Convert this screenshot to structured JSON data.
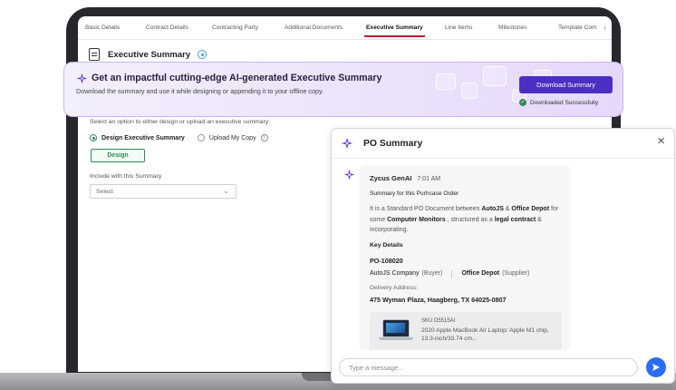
{
  "tabs": [
    {
      "label": "Basic Details",
      "active": false
    },
    {
      "label": "Contract Details",
      "active": false
    },
    {
      "label": "Contracting Party",
      "active": false
    },
    {
      "label": "Additional Documents",
      "active": false
    },
    {
      "label": "Executive Summary",
      "active": true
    },
    {
      "label": "Line Items",
      "active": false
    },
    {
      "label": "Milestones",
      "active": false
    },
    {
      "label": "Template Com",
      "active": false
    }
  ],
  "section": {
    "title": "Executive Summary"
  },
  "form": {
    "hint": "Select an option to either design or upload an executive summary:",
    "option_design": "Design Executive Summary",
    "option_upload": "Upload My Copy",
    "design_button": "Design",
    "include_label": "Include with this Summary",
    "select_value": "Select"
  },
  "banner": {
    "title": "Get an impactful cutting-edge AI-generated Executive Summary",
    "subtitle": "Download the summary and use it while designing or appending it to your offline copy.",
    "download_button": "Download Summary",
    "status": "Downloaded Successfully"
  },
  "panel": {
    "title": "PO Summary",
    "sender": "Zycus GenAI",
    "time": "7:01 AM",
    "subheading": "Summary for this Purhcase Order",
    "body": {
      "t1": "It is a Standard PO Document between ",
      "b1": "AutoJS",
      "t2": " & ",
      "b2": "Office Depot",
      "t3": " for some ",
      "b3": "Computer Monitors",
      "t4": " , structured as a ",
      "b4": "legal contract",
      "t5": " & incorporating."
    },
    "key_details_label": "Key Details",
    "po_number": "PO-108020",
    "buyer_name": "AutoJS Company",
    "buyer_role": "(Buyer)",
    "supplier_name": "Office Depot",
    "supplier_role": "(Supplier)",
    "delivery_label": "Delivery Address:",
    "delivery_address": "475 Wyman Plaza, Haagberg, TX 64025-0807",
    "product": {
      "sku": "SKU D5515AI",
      "name": "2020 Apple MacBook Air Laptop: Apple M1 chip, 13.3-inch/33.74 cm..."
    },
    "composer_placeholder": "Type a message..."
  },
  "colors": {
    "accent_purple": "#4b2fc2",
    "success_green": "#2e8b57",
    "active_tab_red": "#c8102e",
    "send_blue": "#2d6cf6"
  }
}
